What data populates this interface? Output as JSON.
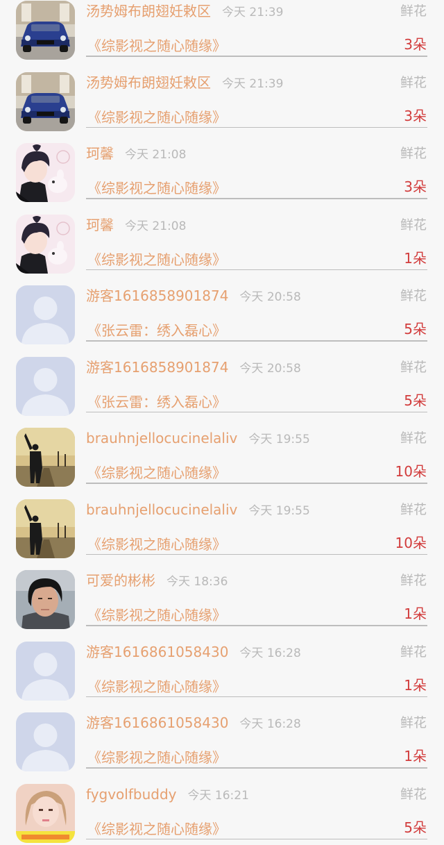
{
  "gifts": [
    {
      "avatar": "car",
      "name": "汤势姆布朗翅妊敕区",
      "time": "今天 21:39",
      "type": "鲜花",
      "book": "《综影视之随心随缘》",
      "count": "3朵"
    },
    {
      "avatar": "car",
      "name": "汤势姆布朗翅妊敕区",
      "time": "今天 21:39",
      "type": "鲜花",
      "book": "《综影视之随心随缘》",
      "count": "3朵"
    },
    {
      "avatar": "anime",
      "name": "珂馨",
      "time": "今天 21:08",
      "type": "鲜花",
      "book": "《综影视之随心随缘》",
      "count": "3朵"
    },
    {
      "avatar": "anime",
      "name": "珂馨",
      "time": "今天 21:08",
      "type": "鲜花",
      "book": "《综影视之随心随缘》",
      "count": "1朵"
    },
    {
      "avatar": "default",
      "name": "游客1616858901874",
      "time": "今天 20:58",
      "type": "鲜花",
      "book": "《张云雷：绣入磊心》",
      "count": "5朵"
    },
    {
      "avatar": "default",
      "name": "游客1616858901874",
      "time": "今天 20:58",
      "type": "鲜花",
      "book": "《张云雷：绣入磊心》",
      "count": "5朵"
    },
    {
      "avatar": "man",
      "name": "brauhnjellocucinelaliv",
      "time": "今天 19:55",
      "type": "鲜花",
      "book": "《综影视之随心随缘》",
      "count": "10朵"
    },
    {
      "avatar": "man",
      "name": "brauhnjellocucinelaliv",
      "time": "今天 19:55",
      "type": "鲜花",
      "book": "《综影视之随心随缘》",
      "count": "10朵"
    },
    {
      "avatar": "woman",
      "name": "可爱的彬彬",
      "time": "今天 18:36",
      "type": "鲜花",
      "book": "《综影视之随心随缘》",
      "count": "1朵"
    },
    {
      "avatar": "default",
      "name": "游客1616861058430",
      "time": "今天 16:28",
      "type": "鲜花",
      "book": "《综影视之随心随缘》",
      "count": "1朵"
    },
    {
      "avatar": "default",
      "name": "游客1616861058430",
      "time": "今天 16:28",
      "type": "鲜花",
      "book": "《综影视之随心随缘》",
      "count": "1朵"
    },
    {
      "avatar": "girl",
      "name": "fygvolfbuddy",
      "time": "今天 16:21",
      "type": "鲜花",
      "book": "《综影视之随心随缘》",
      "count": "5朵"
    }
  ]
}
